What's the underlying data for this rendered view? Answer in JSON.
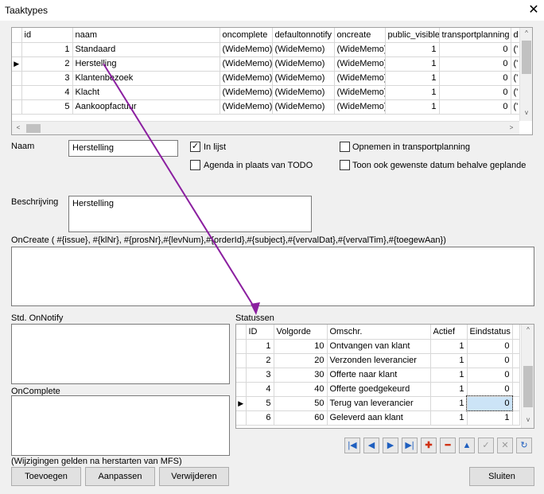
{
  "window": {
    "title": "Taaktypes",
    "close_glyph": "✕"
  },
  "types_grid": {
    "columns": [
      "id",
      "naam",
      "oncomplete",
      "defaultonnotify",
      "oncreate",
      "public_visible",
      "transportplanning",
      "d"
    ],
    "rows": [
      {
        "id": "1",
        "naam": "Standaard",
        "oncomplete": "(WideMemo)",
        "defaultonnotify": "(WideMemo)",
        "oncreate": "(WideMemo)",
        "public_visible": "1",
        "transportplanning": "0",
        "d": "('"
      },
      {
        "id": "2",
        "naam": "Herstelling",
        "oncomplete": "(WideMemo)",
        "defaultonnotify": "(WideMemo)",
        "oncreate": "(WideMemo)",
        "public_visible": "1",
        "transportplanning": "0",
        "d": "('"
      },
      {
        "id": "3",
        "naam": "Klantenbezoek",
        "oncomplete": "(WideMemo)",
        "defaultonnotify": "(WideMemo)",
        "oncreate": "(WideMemo)",
        "public_visible": "1",
        "transportplanning": "0",
        "d": "('"
      },
      {
        "id": "4",
        "naam": "Klacht",
        "oncomplete": "(WideMemo)",
        "defaultonnotify": "(WideMemo)",
        "oncreate": "(WideMemo)",
        "public_visible": "1",
        "transportplanning": "0",
        "d": "('"
      },
      {
        "id": "5",
        "naam": "Aankoopfactuur",
        "oncomplete": "(WideMemo)",
        "defaultonnotify": "(WideMemo)",
        "oncreate": "(WideMemo)",
        "public_visible": "1",
        "transportplanning": "0",
        "d": "('"
      }
    ],
    "current_row_indicator": "▶",
    "scroll_left": "<",
    "scroll_right": ">",
    "scroll_up": "^",
    "scroll_down": "v"
  },
  "form": {
    "naam_label": "Naam",
    "naam_value": "Herstelling",
    "in_lijst_label": "In lijst",
    "in_lijst_checked": "✓",
    "agenda_label": "Agenda in plaats van TODO",
    "transport_label": "Opnemen in transportplanning",
    "gewenste_datum_label": "Toon ook gewenste datum behalve geplande",
    "beschrijving_label": "Beschrijving",
    "beschrijving_value": "Herstelling",
    "oncreate_label": "OnCreate ( #{issue}, #{klNr}, #{prosNr},#{levNum},#{orderId},#{subject},#{vervalDat},#{vervalTim},#{toegewAan})",
    "onnotify_label": "Std. OnNotify",
    "oncomplete_label": "OnComplete",
    "note": "(Wijzigingen gelden na herstarten van MFS)"
  },
  "statussen": {
    "label": "Statussen",
    "columns": [
      "ID",
      "Volgorde",
      "Omschr.",
      "Actief",
      "Eindstatus"
    ],
    "rows": [
      {
        "id": "1",
        "volgorde": "10",
        "omschr": "Ontvangen van klant",
        "actief": "1",
        "eind": "0"
      },
      {
        "id": "2",
        "volgorde": "20",
        "omschr": "Verzonden leverancier",
        "actief": "1",
        "eind": "0"
      },
      {
        "id": "3",
        "volgorde": "30",
        "omschr": "Offerte naar klant",
        "actief": "1",
        "eind": "0"
      },
      {
        "id": "4",
        "volgorde": "40",
        "omschr": "Offerte goedgekeurd",
        "actief": "1",
        "eind": "0"
      },
      {
        "id": "5",
        "volgorde": "50",
        "omschr": "Terug van leverancier",
        "actief": "1",
        "eind": "0"
      },
      {
        "id": "6",
        "volgorde": "60",
        "omschr": "Geleverd aan klant",
        "actief": "1",
        "eind": "1"
      }
    ],
    "current_row_indicator": "▶",
    "nav": {
      "first": "|◀",
      "prior": "◀",
      "next": "▶",
      "last": "▶|",
      "insert": "✚",
      "delete": "━",
      "edit": "▲",
      "post": "✓",
      "cancel": "✕",
      "refresh": "↻"
    }
  },
  "buttons": {
    "add": "Toevoegen",
    "edit": "Aanpassen",
    "delete": "Verwijderen",
    "close": "Sluiten"
  },
  "colors": {
    "annotation_arrow": "#8b1fa0"
  }
}
